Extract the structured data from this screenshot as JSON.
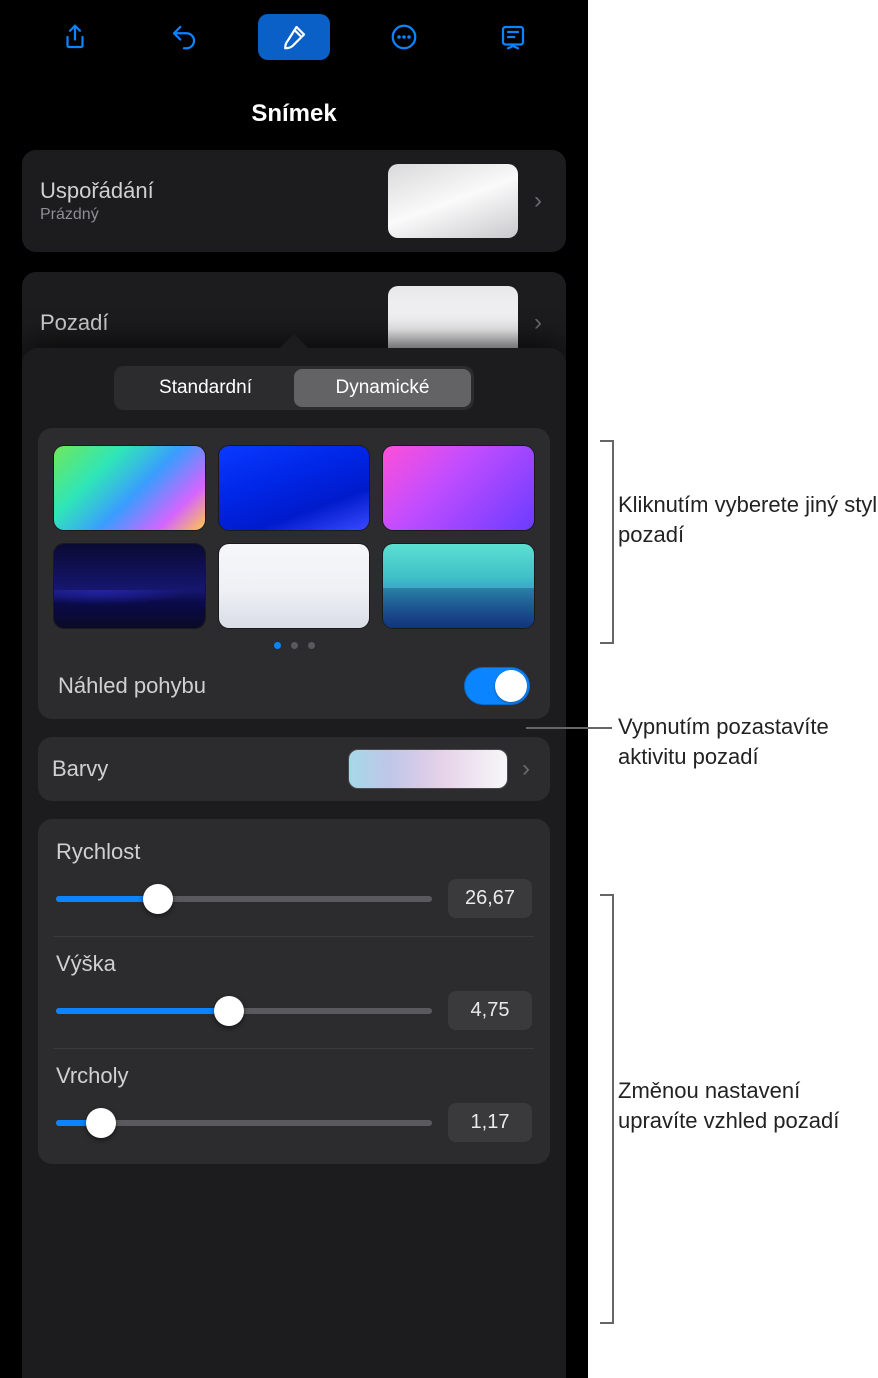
{
  "toolbar": {
    "icons": [
      "share-icon",
      "undo-icon",
      "format-brush-icon",
      "more-icon",
      "presenter-icon"
    ],
    "active_index": 2
  },
  "title": "Snímek",
  "layout_row": {
    "label": "Uspořádání",
    "sublabel": "Prázdný"
  },
  "background_row": {
    "label": "Pozadí"
  },
  "segmented": {
    "options": [
      "Standardní",
      "Dynamické"
    ],
    "selected_index": 1
  },
  "gallery": {
    "swatches": [
      "gradient-rainbow",
      "gradient-blue",
      "gradient-magenta",
      "waves-dark-blue",
      "clouds-light",
      "mountains-teal"
    ],
    "page_count": 3,
    "page_active": 0
  },
  "motion_preview": {
    "label": "Náhled pohybu",
    "on": true
  },
  "colors_row": {
    "label": "Barvy"
  },
  "sliders": [
    {
      "label": "Rychlost",
      "value_text": "26,67",
      "fill_pct": 27
    },
    {
      "label": "Výška",
      "value_text": "4,75",
      "fill_pct": 46
    },
    {
      "label": "Vrcholy",
      "value_text": "1,17",
      "fill_pct": 12
    }
  ],
  "callouts": {
    "styles": "Kliknutím vyberete jiný styl pozadí",
    "toggle": "Vypnutím pozastavíte aktivitu pozadí",
    "sliders": "Změnou nastavení upravíte vzhled pozadí"
  }
}
